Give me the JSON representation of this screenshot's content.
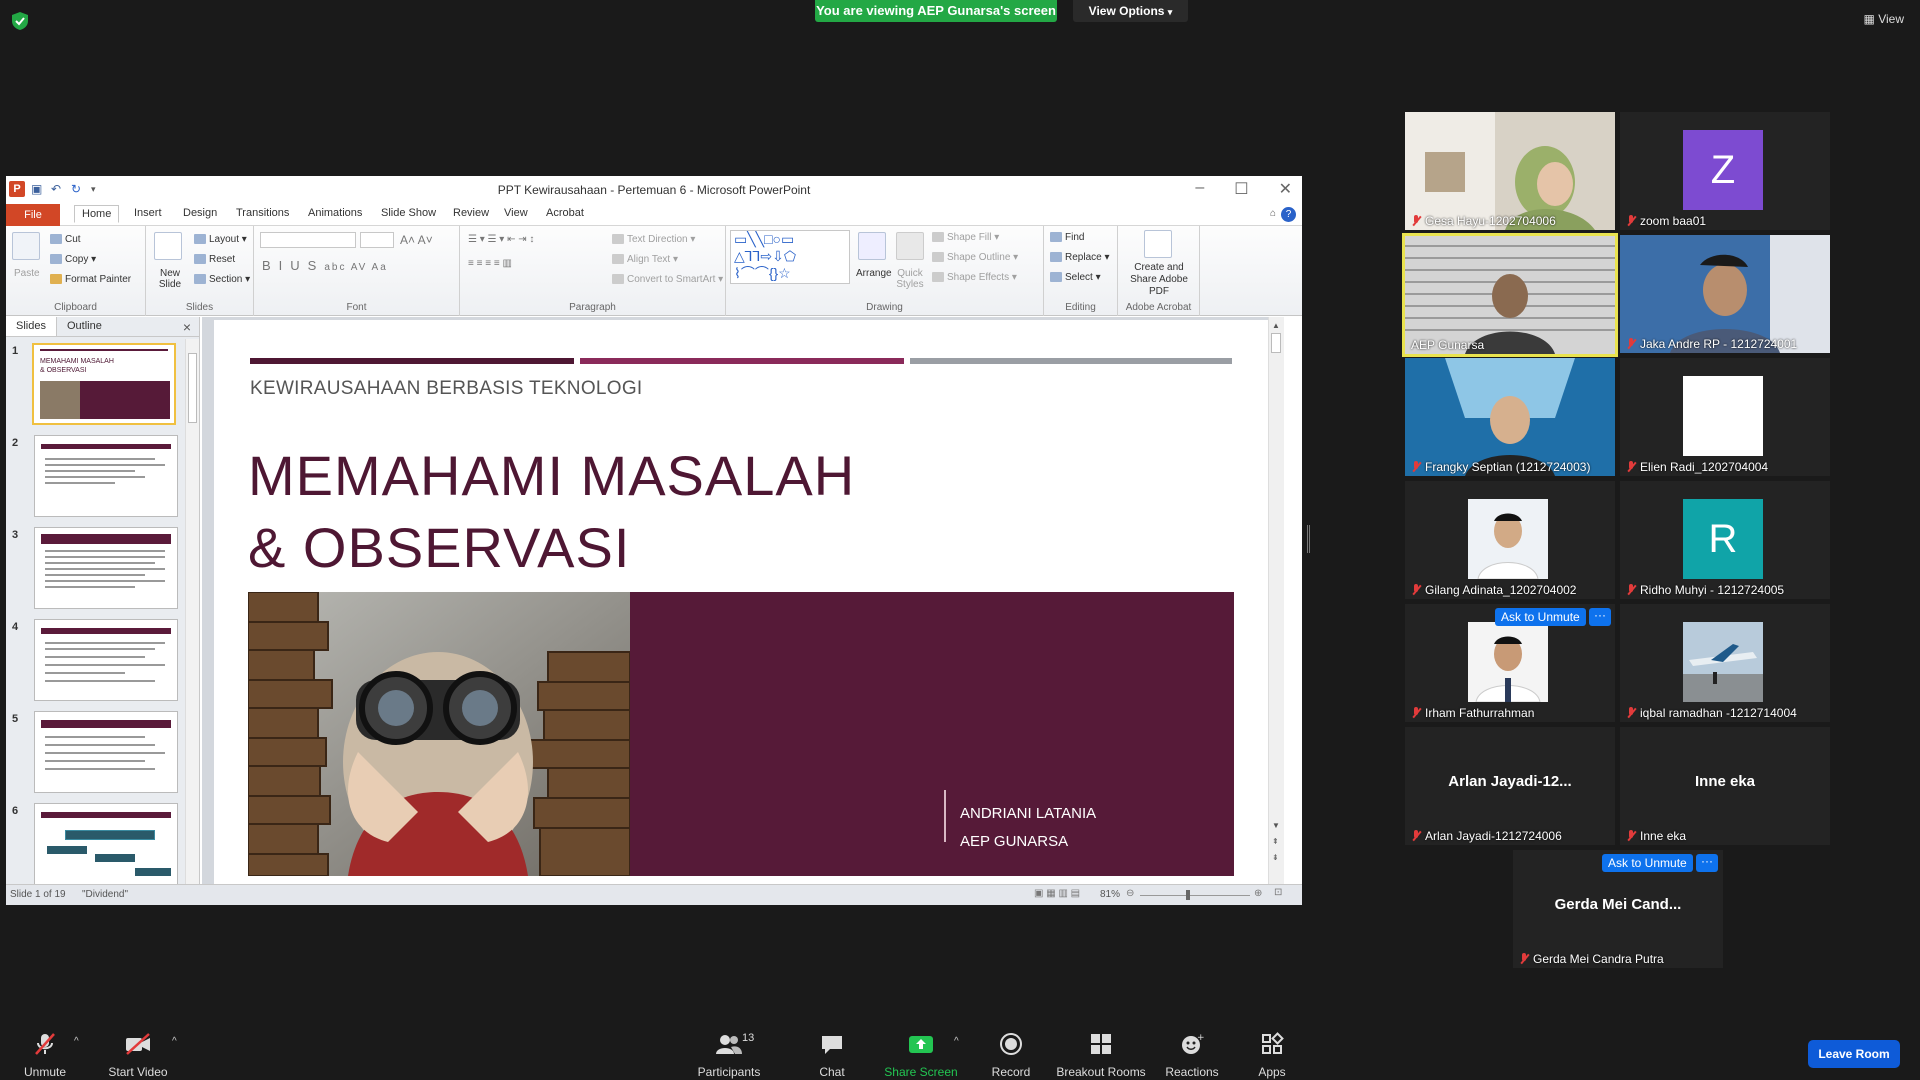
{
  "zoom": {
    "banner": "You are viewing AEP Gunarsa's screen",
    "view_options": "View Options",
    "view_label": "View",
    "leave_label": "Leave Room",
    "toolbar": {
      "unmute": "Unmute",
      "start_video": "Start Video",
      "participants": "Participants",
      "participants_count": "13",
      "chat": "Chat",
      "share_screen": "Share Screen",
      "record": "Record",
      "breakout": "Breakout Rooms",
      "reactions": "Reactions",
      "apps": "Apps"
    },
    "ask_to_unmute": "Ask to Unmute",
    "more": "···"
  },
  "participants": [
    {
      "name": "Gesa Hayu-1202704006",
      "type": "video"
    },
    {
      "name": "zoom baa01",
      "type": "avatar",
      "letter": "Z",
      "color": "#7d4bd1"
    },
    {
      "name": "AEP Gunarsa",
      "type": "video",
      "active": true
    },
    {
      "name": "Jaka Andre RP - 1212724001",
      "type": "video"
    },
    {
      "name": "Frangky Septian (1212724003)",
      "type": "video"
    },
    {
      "name": "Elien Radi_1202704004",
      "type": "avatar",
      "letter": "",
      "color": "#ffffff"
    },
    {
      "name": "Gilang Adinata_1202704002",
      "type": "photo"
    },
    {
      "name": "Ridho Muhyi - 1212724005",
      "type": "avatar",
      "letter": "R",
      "color": "#10a4a8"
    },
    {
      "name": "Irham Fathurrahman",
      "type": "photo"
    },
    {
      "name": "iqbal ramadhan -1212714004",
      "type": "photo"
    },
    {
      "name": "Arlan Jayadi-1212724006",
      "type": "text",
      "short": "Arlan Jayadi-12..."
    },
    {
      "name": "Inne eka",
      "type": "text",
      "short": "Inne eka"
    },
    {
      "name": "Gerda Mei Candra Putra",
      "type": "text",
      "short": "Gerda Mei Cand..."
    }
  ],
  "ppt": {
    "window_title": "PPT Kewirausahaan - Pertemuan 6 - Microsoft PowerPoint",
    "tabs": [
      "File",
      "Home",
      "Insert",
      "Design",
      "Transitions",
      "Animations",
      "Slide Show",
      "Review",
      "View",
      "Acrobat"
    ],
    "ribbon": {
      "clipboard": {
        "label": "Clipboard",
        "paste": "Paste",
        "cut": "Cut",
        "copy": "Copy",
        "format_painter": "Format Painter"
      },
      "slides": {
        "label": "Slides",
        "new_slide": "New Slide",
        "layout": "Layout",
        "reset": "Reset",
        "section": "Section"
      },
      "font": {
        "label": "Font"
      },
      "paragraph": {
        "label": "Paragraph",
        "text_direction": "Text Direction",
        "align_text": "Align Text",
        "convert_smartart": "Convert to SmartArt"
      },
      "drawing": {
        "label": "Drawing",
        "arrange": "Arrange",
        "quick_styles": "Quick Styles",
        "shape_fill": "Shape Fill",
        "shape_outline": "Shape Outline",
        "shape_effects": "Shape Effects"
      },
      "editing": {
        "label": "Editing",
        "find": "Find",
        "replace": "Replace",
        "select": "Select"
      },
      "acrobat": {
        "label": "Adobe Acrobat",
        "create_share": "Create and Share Adobe PDF"
      }
    },
    "left_pane": {
      "slides_tab": "Slides",
      "outline_tab": "Outline",
      "close": "×"
    },
    "thumbnails": [
      "1",
      "2",
      "3",
      "4",
      "5",
      "6"
    ],
    "thumb1_title": "MEMAHAMI MASALAH & OBSERVASI",
    "slide": {
      "subtitle": "KEWIRAUSAHAAN BERBASIS TEKNOLOGI",
      "title_line1": "MEMAHAMI MASALAH",
      "title_line2": "& OBSERVASI",
      "author1": "ANDRIANI LATANIA",
      "author2": "AEP GUNARSA",
      "bar_colors": [
        "#4e1733",
        "#8a2a5a",
        "#9a9ea4"
      ]
    },
    "status": {
      "slide_info": "Slide 1 of 19",
      "theme": "\"Dividend\"",
      "zoom": "81%"
    }
  }
}
